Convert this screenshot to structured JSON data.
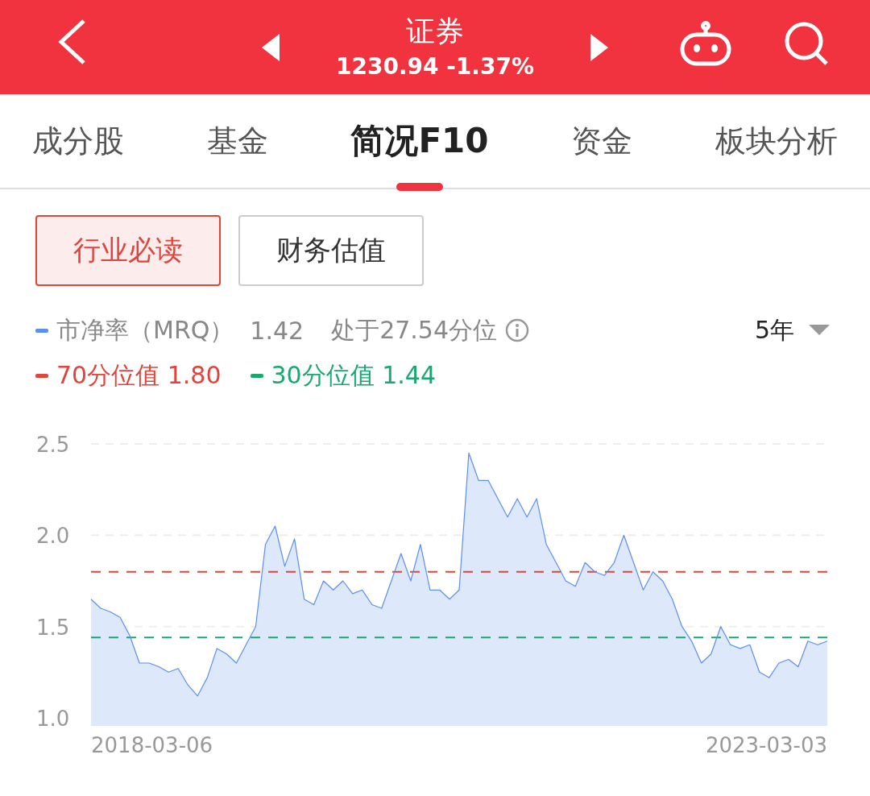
{
  "header": {
    "title": "证券",
    "quote": "1230.94 -1.37%"
  },
  "tabs": [
    {
      "label": "成分股",
      "selected": false
    },
    {
      "label": "基金",
      "selected": false
    },
    {
      "label": "简况F10",
      "selected": true
    },
    {
      "label": "资金",
      "selected": false
    },
    {
      "label": "板块分析",
      "selected": false
    }
  ],
  "sub_tabs": [
    {
      "label": "行业必读",
      "selected": true
    },
    {
      "label": "财务估值",
      "selected": false
    }
  ],
  "legend": {
    "value": "1.42",
    "percentile": "处于27.54分位",
    "period": "5年"
  },
  "axis_dates": [
    "2018-03-06",
    "2023-03-03"
  ],
  "chart_data": {
    "type": "area",
    "ylim": [
      1.0,
      2.5
    ],
    "yticks": [
      {
        "value": 1.0,
        "label": "1.0"
      },
      {
        "value": 1.5,
        "label": "1.5"
      },
      {
        "value": 2.0,
        "label": "2.0"
      },
      {
        "value": 2.5,
        "label": "2.5"
      }
    ],
    "series": [
      {
        "name": "市净率（MRQ）",
        "color": "#5b8ff0",
        "values": [
          1.65,
          1.6,
          1.58,
          1.55,
          1.45,
          1.3,
          1.3,
          1.28,
          1.25,
          1.27,
          1.18,
          1.12,
          1.22,
          1.38,
          1.35,
          1.3,
          1.4,
          1.5,
          1.95,
          2.05,
          1.83,
          1.98,
          1.65,
          1.62,
          1.75,
          1.7,
          1.75,
          1.68,
          1.7,
          1.62,
          1.6,
          1.75,
          1.9,
          1.75,
          1.95,
          1.7,
          1.7,
          1.65,
          1.7,
          2.45,
          2.3,
          2.3,
          2.2,
          2.1,
          2.2,
          2.1,
          2.2,
          1.95,
          1.85,
          1.75,
          1.72,
          1.85,
          1.8,
          1.78,
          1.85,
          2.0,
          1.85,
          1.7,
          1.8,
          1.75,
          1.65,
          1.5,
          1.42,
          1.3,
          1.35,
          1.5,
          1.4,
          1.38,
          1.4,
          1.25,
          1.22,
          1.3,
          1.32,
          1.28,
          1.42,
          1.4,
          1.42
        ]
      },
      {
        "name": "70分位值 1.80",
        "type": "line",
        "line_style": "dashed",
        "color": "#e0443c",
        "values": [
          1.8,
          1.8,
          1.8,
          1.8,
          1.8,
          1.8,
          1.8,
          1.8,
          1.8,
          1.8,
          1.8,
          1.8,
          1.8,
          1.8,
          1.8,
          1.8,
          1.8,
          1.8,
          1.8,
          1.8,
          1.8,
          1.8,
          1.8,
          1.8,
          1.8,
          1.8,
          1.8,
          1.8,
          1.8,
          1.8,
          1.8,
          1.8,
          1.8,
          1.8,
          1.8,
          1.8,
          1.8,
          1.8,
          1.8,
          1.8,
          1.8,
          1.8,
          1.8,
          1.8,
          1.8,
          1.8,
          1.8,
          1.8,
          1.8,
          1.8,
          1.8,
          1.8,
          1.8,
          1.8,
          1.8,
          1.8,
          1.8,
          1.8,
          1.8,
          1.8,
          1.8,
          1.8,
          1.8,
          1.8,
          1.8,
          1.8,
          1.8,
          1.8,
          1.8,
          1.8,
          1.8,
          1.8,
          1.8,
          1.8,
          1.8,
          1.8,
          1.8
        ]
      },
      {
        "name": "30分位值 1.44",
        "type": "line",
        "line_style": "dashed",
        "color": "#18a870",
        "values": [
          1.44,
          1.44,
          1.44,
          1.44,
          1.44,
          1.44,
          1.44,
          1.44,
          1.44,
          1.44,
          1.44,
          1.44,
          1.44,
          1.44,
          1.44,
          1.44,
          1.44,
          1.44,
          1.44,
          1.44,
          1.44,
          1.44,
          1.44,
          1.44,
          1.44,
          1.44,
          1.44,
          1.44,
          1.44,
          1.44,
          1.44,
          1.44,
          1.44,
          1.44,
          1.44,
          1.44,
          1.44,
          1.44,
          1.44,
          1.44,
          1.44,
          1.44,
          1.44,
          1.44,
          1.44,
          1.44,
          1.44,
          1.44,
          1.44,
          1.44,
          1.44,
          1.44,
          1.44,
          1.44,
          1.44,
          1.44,
          1.44,
          1.44,
          1.44,
          1.44,
          1.44,
          1.44,
          1.44,
          1.44,
          1.44,
          1.44,
          1.44,
          1.44,
          1.44,
          1.44,
          1.44,
          1.44,
          1.44,
          1.44,
          1.44,
          1.44,
          1.44
        ]
      }
    ]
  }
}
